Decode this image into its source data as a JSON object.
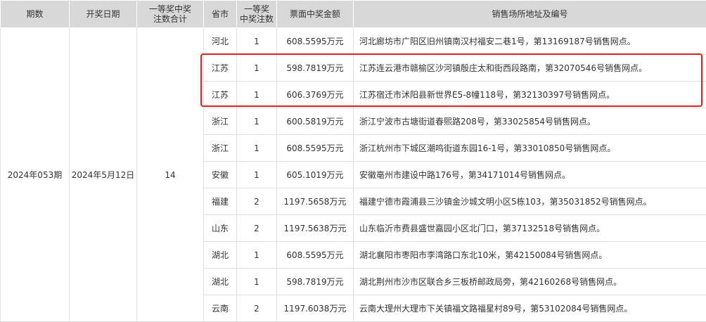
{
  "headers": {
    "period": "期数",
    "date": "开奖日期",
    "total_line1": "一等奖中奖",
    "total_line2": "注数合计",
    "province": "省市",
    "count_line1": "一等奖",
    "count_line2": "中奖注数",
    "amount": "票面中奖金额",
    "address": "销售场所地址及编号"
  },
  "period": "2024年053期",
  "draw_date": "2024年5月12日",
  "total": "14",
  "rows": [
    {
      "province": "河北",
      "count": "1",
      "amount": "608.5595万元",
      "address": "河北廊坊市广阳区旧州镇南汉村福安二巷1号，第13169187号销售网点。"
    },
    {
      "province": "江苏",
      "count": "1",
      "amount": "598.7819万元",
      "address": "江苏连云港市赣榆区沙河镇殷庄太和街西段路南，第32070546号销售网点。"
    },
    {
      "province": "江苏",
      "count": "1",
      "amount": "606.3769万元",
      "address": "江苏宿迁市沭阳县新世界E5-8幢118号，第32130397号销售网点。"
    },
    {
      "province": "浙江",
      "count": "1",
      "amount": "600.5819万元",
      "address": "浙江宁波市古塘街道春熙路208号，第33025854号销售网点。"
    },
    {
      "province": "浙江",
      "count": "1",
      "amount": "608.5595万元",
      "address": "浙江杭州市下城区潮鸣街道东园16-1号，第33010850号销售网点。"
    },
    {
      "province": "安徽",
      "count": "1",
      "amount": "605.1019万元",
      "address": "安徽亳州市建设中路176号，第34171014号销售网点。"
    },
    {
      "province": "福建",
      "count": "2",
      "amount": "1197.5658万元",
      "address": "福建宁德市霞浦县三沙镇金沙城文明小区5栋103，第35031852号销售网点。"
    },
    {
      "province": "山东",
      "count": "2",
      "amount": "1197.5638万元",
      "address": "山东临沂市费县盛世嘉园小区北门口，第37132518号销售网点。"
    },
    {
      "province": "湖北",
      "count": "1",
      "amount": "608.5595万元",
      "address": "湖北襄阳市枣阳市李湾路口东北10米，第42150084号销售网点。"
    },
    {
      "province": "湖北",
      "count": "1",
      "amount": "598.7819万元",
      "address": "湖北荆州市沙市区联合乡三板桥邮政局旁，第42160268号销售网点。"
    },
    {
      "province": "云南",
      "count": "2",
      "amount": "1197.6038万元",
      "address": "云南大理州大理市下关镇福文路福星村89号，第53102084号销售网点。"
    }
  ],
  "highlight_color": "#e41e1e"
}
